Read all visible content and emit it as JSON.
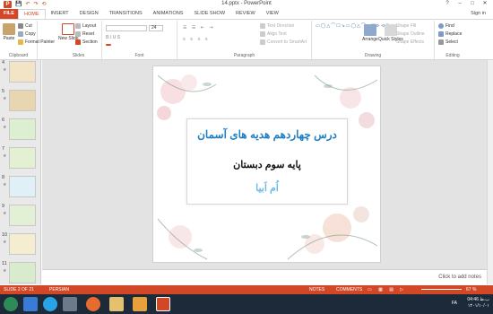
{
  "window": {
    "title": "14.pptx - PowerPoint",
    "minimize": "–",
    "restore": "□",
    "close": "✕",
    "help": "?"
  },
  "qat": {
    "save": "💾",
    "undo": "↶",
    "redo": "↷",
    "start": "⟲"
  },
  "tabs": [
    "FILE",
    "HOME",
    "INSERT",
    "DESIGN",
    "TRANSITIONS",
    "ANIMATIONS",
    "SLIDE SHOW",
    "REVIEW",
    "VIEW"
  ],
  "active_tab": "HOME",
  "signin": "Sign in",
  "ribbon": {
    "clipboard": {
      "label": "Clipboard",
      "paste": "Paste",
      "cut": "Cut",
      "copy": "Copy",
      "format_painter": "Format Painter"
    },
    "slides": {
      "label": "Slides",
      "new_slide": "New Slide",
      "layout": "Layout",
      "reset": "Reset",
      "section": "Section"
    },
    "font": {
      "label": "Font",
      "size": "24"
    },
    "paragraph": {
      "label": "Paragraph",
      "text_direction": "Text Direction",
      "align_text": "Align Text",
      "convert_smartart": "Convert to SmartArt"
    },
    "drawing": {
      "label": "Drawing",
      "arrange": "Arrange",
      "quick_styles": "Quick Styles",
      "shape_fill": "Shape Fill",
      "shape_outline": "Shape Outline",
      "shape_effects": "Shape Effects"
    },
    "editing": {
      "label": "Editing",
      "find": "Find",
      "replace": "Replace",
      "select": "Select"
    }
  },
  "thumbnails": [
    {
      "num": "4",
      "color": "#d9a86c"
    },
    {
      "num": "5",
      "color": "#b08a56"
    },
    {
      "num": "6",
      "color": "#8fbf6a"
    },
    {
      "num": "7",
      "color": "#a7c97a"
    },
    {
      "num": "8",
      "color": "#8cc8e0"
    },
    {
      "num": "9",
      "color": "#9bc27c"
    },
    {
      "num": "10",
      "color": "#e0c97a"
    },
    {
      "num": "11",
      "color": "#7fb36a"
    }
  ],
  "slide": {
    "title": "درس چهاردهم هدیه های آسمان",
    "subtitle": "پایه سوم دبستان",
    "author": "اُم اَبیا"
  },
  "notes_placeholder": "Click to add notes",
  "status": {
    "slide_info": "SLIDE 2 OF 21",
    "language": "PERSIAN",
    "notes": "NOTES",
    "comments": "COMMENTS",
    "zoom": "67 %"
  },
  "tray": {
    "time": "04:46 ب.ظ",
    "date": "۱۴۰۱/۱۰/۰۱",
    "lang": "FA"
  },
  "colors": {
    "accent": "#d24726",
    "title_blue": "#1f7fc4",
    "author_blue": "#6fb9e8"
  }
}
